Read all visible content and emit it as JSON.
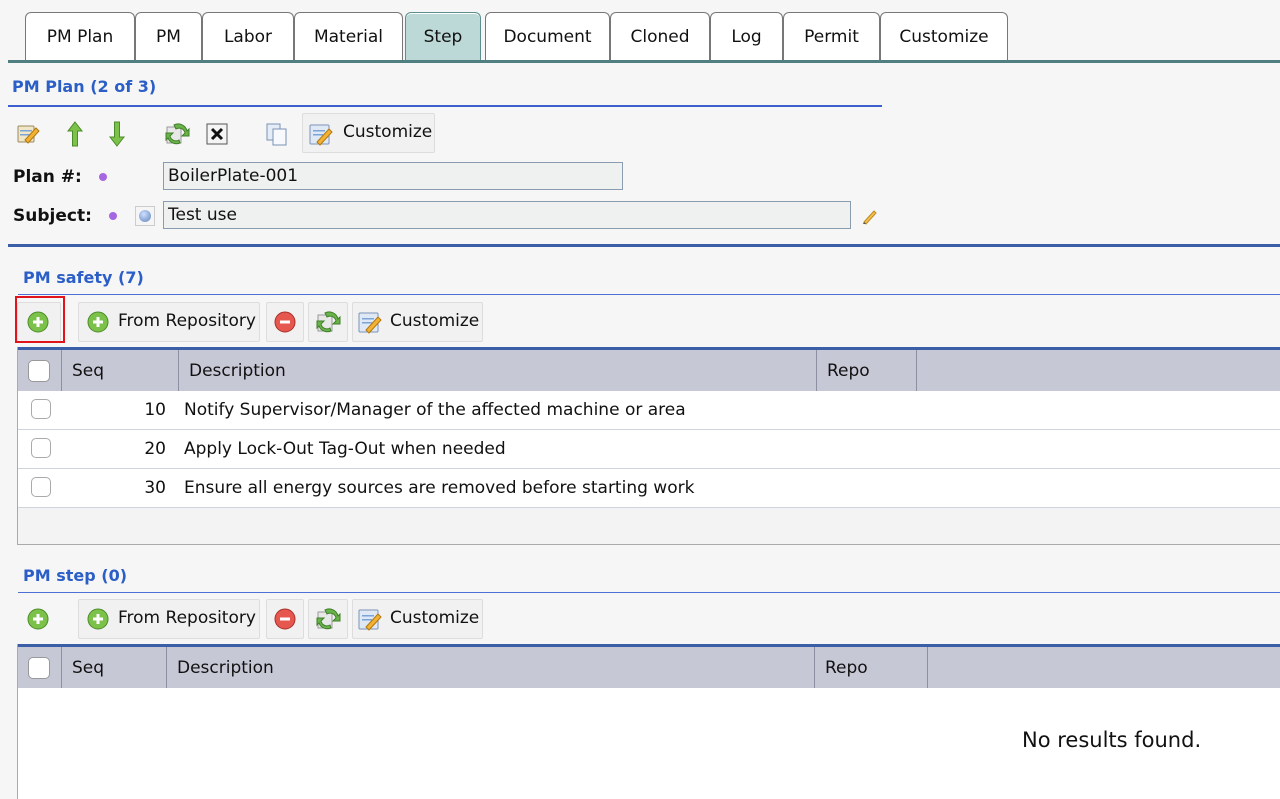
{
  "tabs": [
    {
      "label": "PM Plan"
    },
    {
      "label": "PM"
    },
    {
      "label": "Labor"
    },
    {
      "label": "Material"
    },
    {
      "label": "Step"
    },
    {
      "label": "Document"
    },
    {
      "label": "Cloned"
    },
    {
      "label": "Log"
    },
    {
      "label": "Permit"
    },
    {
      "label": "Customize"
    }
  ],
  "active_tab": "Step",
  "plan": {
    "title": "PM Plan (2 of 3)",
    "toolbar_customize": "Customize",
    "plan_label": "Plan #:",
    "plan_value": "BoilerPlate-001",
    "subject_label": "Subject:",
    "subject_value": "Test use"
  },
  "safety": {
    "title": "PM safety (7)",
    "toolbar": {
      "from_repo": "From Repository",
      "customize": "Customize"
    },
    "columns": {
      "seq": "Seq",
      "description": "Description",
      "repo": "Repo"
    },
    "rows": [
      {
        "seq": "10",
        "description": "Notify Supervisor/Manager of the affected machine or area"
      },
      {
        "seq": "20",
        "description": "Apply Lock-Out Tag-Out when needed"
      },
      {
        "seq": "30",
        "description": "Ensure all energy sources are removed before starting work"
      }
    ]
  },
  "step": {
    "title": "PM step (0)",
    "toolbar": {
      "from_repo": "From Repository",
      "customize": "Customize"
    },
    "columns": {
      "seq": "Seq",
      "description": "Description",
      "repo": "Repo"
    },
    "empty_text": "No results found."
  },
  "colors": {
    "section_title": "#2b5fc7",
    "active_tab": "#bcd9d8",
    "highlight": "#e0141a",
    "header_bg": "#c7c8d6"
  },
  "icons": [
    "edit-icon",
    "arrow-up-icon",
    "arrow-down-icon",
    "refresh-icon",
    "delete-x-icon",
    "copy-icon",
    "customize-icon",
    "add-icon",
    "remove-icon",
    "pencil-icon",
    "required-dot-icon",
    "info-icon"
  ]
}
